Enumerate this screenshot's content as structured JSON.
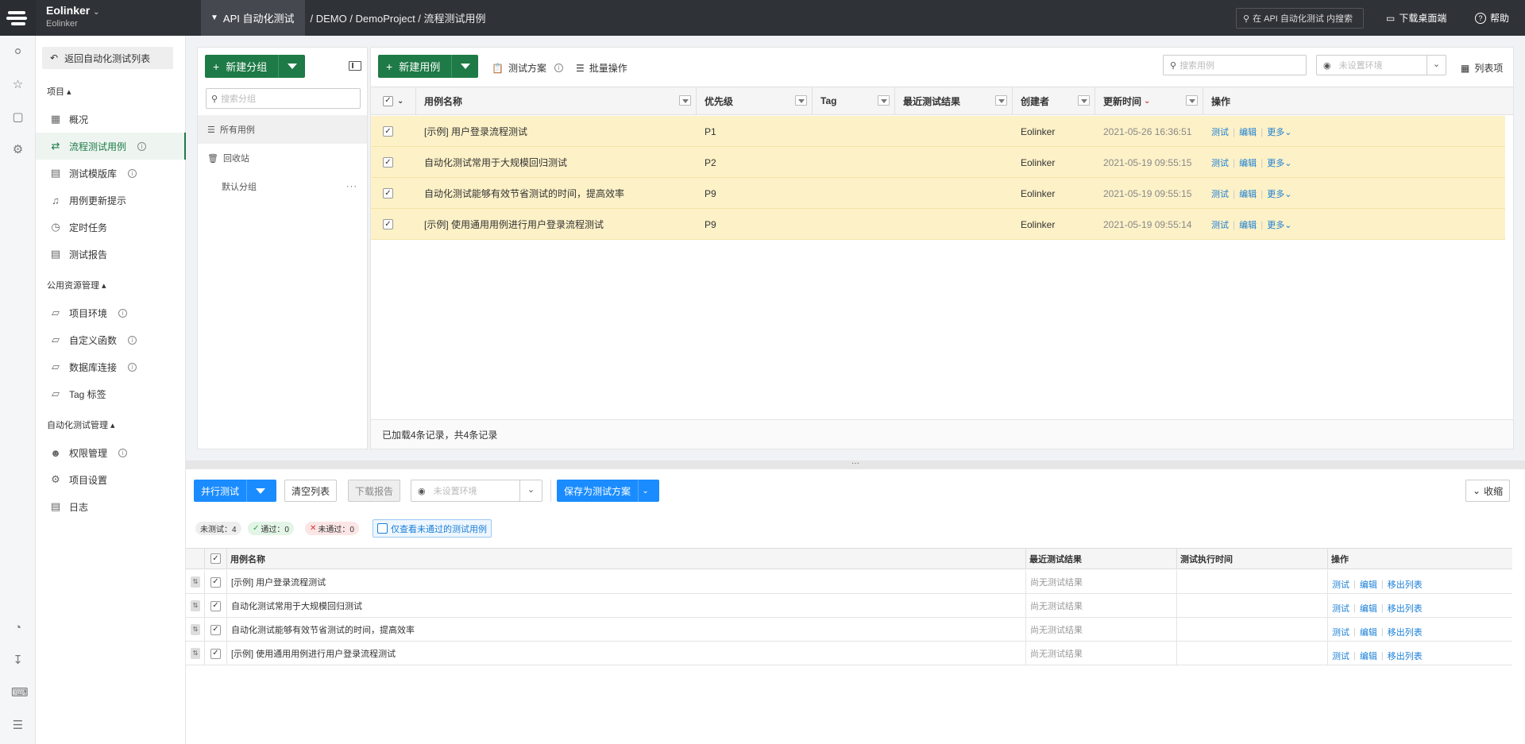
{
  "topbar": {
    "org_name": "Eolinker",
    "org_sub": "Eolinker",
    "module": "API 自动化测试",
    "path": "/ DEMO / DemoProject / 流程测试用例",
    "search_placeholder": "在 API 自动化测试 内搜索",
    "download": "下载桌面端",
    "help": "帮助"
  },
  "sidebar": {
    "back": "返回自动化测试列表",
    "section_project": "项目",
    "section_public": "公用资源管理",
    "section_auto": "自动化测试管理",
    "items": [
      {
        "label": "概况",
        "icon": "dashboard-icon"
      },
      {
        "label": "流程测试用例",
        "icon": "flow-icon",
        "info": true,
        "active": true
      },
      {
        "label": "测试模版库",
        "icon": "template-icon",
        "info": true
      },
      {
        "label": "用例更新提示",
        "icon": "bell-icon"
      },
      {
        "label": "定时任务",
        "icon": "clock-icon"
      },
      {
        "label": "测试报告",
        "icon": "report-icon"
      }
    ],
    "public_items": [
      {
        "label": "项目环境",
        "info": true
      },
      {
        "label": "自定义函数",
        "info": true
      },
      {
        "label": "数据库连接",
        "info": true
      },
      {
        "label": "Tag 标签",
        "info": false
      }
    ],
    "auto_items": [
      {
        "label": "权限管理",
        "info": true
      },
      {
        "label": "项目设置",
        "info": false
      },
      {
        "label": "日志",
        "info": false
      }
    ]
  },
  "tree": {
    "new_group": "新建分组",
    "search_placeholder": "搜索分组",
    "all_cases": "所有用例",
    "recycle": "回收站",
    "default_group": "默认分组"
  },
  "toolbar": {
    "new_case": "新建用例",
    "test_plan": "测试方案",
    "batch": "批量操作",
    "search_placeholder": "搜索用例",
    "env_placeholder": "未设置环境",
    "columns": "列表项"
  },
  "table": {
    "headers": {
      "name": "用例名称",
      "priority": "优先级",
      "tag": "Tag",
      "last_result": "最近测试结果",
      "creator": "创建者",
      "updated": "更新时间",
      "ops": "操作"
    },
    "rows": [
      {
        "name": "[示例] 用户登录流程测试",
        "priority": "P1",
        "tag": "",
        "result": "",
        "creator": "Eolinker",
        "updated": "2021-05-26 16:36:51"
      },
      {
        "name": "自动化测试常用于大规模回归测试",
        "priority": "P2",
        "tag": "",
        "result": "",
        "creator": "Eolinker",
        "updated": "2021-05-19 09:55:15"
      },
      {
        "name": "自动化测试能够有效节省测试的时间，提高效率",
        "priority": "P9",
        "tag": "",
        "result": "",
        "creator": "Eolinker",
        "updated": "2021-05-19 09:55:15"
      },
      {
        "name": "[示例] 使用通用用例进行用户登录流程测试",
        "priority": "P9",
        "tag": "",
        "result": "",
        "creator": "Eolinker",
        "updated": "2021-05-19 09:55:14"
      }
    ],
    "op_test": "测试",
    "op_edit": "编辑",
    "op_more": "更多",
    "footer": "已加载4条记录，共4条记录"
  },
  "bottom": {
    "parallel": "并行测试",
    "clear": "清空列表",
    "download_report": "下载报告",
    "env_placeholder": "未设置环境",
    "save_plan": "保存为测试方案",
    "collapse": "收缩",
    "chip_untested": "未测试：4",
    "chip_pass": "通过：0",
    "chip_fail": "未通过：0",
    "only_failed": "仅查看未通过的测试用例",
    "headers": {
      "name": "用例名称",
      "result": "最近测试结果",
      "time": "测试执行时间",
      "ops": "操作"
    },
    "rows": [
      {
        "name": "[示例] 用户登录流程测试",
        "result": "尚无测试结果",
        "time": ""
      },
      {
        "name": "自动化测试常用于大规模回归测试",
        "result": "尚无测试结果",
        "time": ""
      },
      {
        "name": "自动化测试能够有效节省测试的时间，提高效率",
        "result": "尚无测试结果",
        "time": ""
      },
      {
        "name": "[示例] 使用通用用例进行用户登录流程测试",
        "result": "尚无测试结果",
        "time": ""
      }
    ],
    "op_test": "测试",
    "op_edit": "编辑",
    "op_remove": "移出列表"
  },
  "colors": {
    "brand_green": "#1e7a46",
    "selected_row": "#fdf1c7",
    "primary_blue": "#1a8cff",
    "link_blue": "#1a7fd6"
  }
}
